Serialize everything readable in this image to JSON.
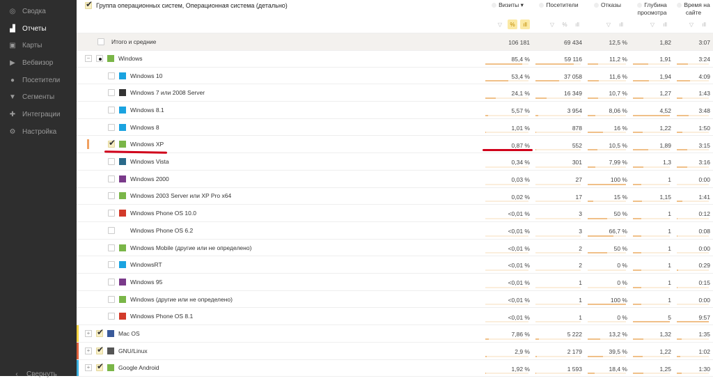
{
  "sidebar": {
    "items": [
      {
        "label": "Сводка",
        "icon": "dashboard-icon",
        "glyph": "◎"
      },
      {
        "label": "Отчеты",
        "icon": "bar-chart-icon",
        "glyph": "▟",
        "active": true
      },
      {
        "label": "Карты",
        "icon": "map-icon",
        "glyph": "▣"
      },
      {
        "label": "Вебвизор",
        "icon": "play-icon",
        "glyph": "▶"
      },
      {
        "label": "Посетители",
        "icon": "user-icon",
        "glyph": "●"
      },
      {
        "label": "Сегменты",
        "icon": "filter-icon",
        "glyph": "▼"
      },
      {
        "label": "Интеграции",
        "icon": "puzzle-icon",
        "glyph": "✚"
      },
      {
        "label": "Настройка",
        "icon": "gear-icon",
        "glyph": "⚙"
      }
    ],
    "collapse": "Свернуть"
  },
  "grouping": "Группа операционных систем, Операционная система (детально)",
  "columns": [
    {
      "label": "Визиты ▾"
    },
    {
      "label": "Посетители"
    },
    {
      "label": "Отказы"
    },
    {
      "label": "Глубина просмотра"
    },
    {
      "label": "Время на сайте"
    }
  ],
  "totals": {
    "label": "Итого и средние",
    "values": [
      "106 181",
      "69 434",
      "12,5 %",
      "1,82",
      "3:07"
    ]
  },
  "rows": [
    {
      "name": "Windows",
      "level": 0,
      "expand": "−",
      "icon": "windows-xp-icon",
      "color": "#7ab648",
      "values": [
        "85,4 %",
        "59 116",
        "11,2 %",
        "1,91",
        "3:24"
      ],
      "bars": [
        0.85,
        0.85,
        0.28,
        0.42,
        0.35
      ]
    },
    {
      "name": "Windows 10",
      "level": 1,
      "icon": "windows-10-icon",
      "color": "#1aa3e0",
      "values": [
        "53,4 %",
        "37 058",
        "11,6 %",
        "1,94",
        "4:09"
      ],
      "bars": [
        0.53,
        0.53,
        0.29,
        0.43,
        0.42
      ]
    },
    {
      "name": "Windows 7 или 2008 Server",
      "level": 1,
      "icon": "windows-7-icon",
      "color": "#333",
      "values": [
        "24,1 %",
        "16 349",
        "10,7 %",
        "1,27",
        "1:43"
      ],
      "bars": [
        0.24,
        0.24,
        0.27,
        0.28,
        0.17
      ]
    },
    {
      "name": "Windows 8.1",
      "level": 1,
      "icon": "windows-8-icon",
      "color": "#1aa3e0",
      "values": [
        "5,57 %",
        "3 954",
        "8,06 %",
        "4,52",
        "3:48"
      ],
      "bars": [
        0.06,
        0.06,
        0.2,
        1,
        0.38
      ]
    },
    {
      "name": "Windows 8",
      "level": 1,
      "icon": "windows-8-icon",
      "color": "#1aa3e0",
      "values": [
        "1,01 %",
        "878",
        "16 %",
        "1,22",
        "1:50"
      ],
      "bars": [
        0.01,
        0.01,
        0.4,
        0.27,
        0.18
      ]
    },
    {
      "name": "Windows XP",
      "level": 1,
      "checked": true,
      "icon": "windows-xp-icon",
      "color": "#7ab648",
      "values": [
        "0,87 %",
        "552",
        "10,5 %",
        "1,89",
        "3:15"
      ],
      "bars": [
        0.01,
        0.01,
        0.26,
        0.42,
        0.33
      ],
      "mark": "#f0a060"
    },
    {
      "name": "Windows Vista",
      "level": 1,
      "icon": "windows-vista-icon",
      "color": "#2a6a8a",
      "values": [
        "0,34 %",
        "301",
        "7,99 %",
        "1,3",
        "3:16"
      ],
      "bars": [
        0,
        0,
        0.2,
        0.29,
        0.33
      ]
    },
    {
      "name": "Windows 2000",
      "level": 1,
      "icon": "windows-2000-icon",
      "color": "#7a3a8a",
      "values": [
        "0,03 %",
        "27",
        "100 %",
        "1",
        "0:00"
      ],
      "bars": [
        0,
        0,
        1,
        0.22,
        0
      ]
    },
    {
      "name": "Windows 2003 Server или XP Pro x64",
      "level": 1,
      "icon": "windows-xp-icon",
      "color": "#7ab648",
      "values": [
        "0,02 %",
        "17",
        "15 %",
        "1,15",
        "1:41"
      ],
      "bars": [
        0,
        0,
        0.15,
        0.25,
        0.17
      ]
    },
    {
      "name": "Windows Phone OS 10.0",
      "level": 1,
      "icon": "windows-phone-icon",
      "color": "#d23a2a",
      "values": [
        "<0,01 %",
        "3",
        "50 %",
        "1",
        "0:12"
      ],
      "bars": [
        0,
        0,
        0.5,
        0.22,
        0.02
      ]
    },
    {
      "name": "Windows Phone OS 6.2",
      "level": 1,
      "icon": "",
      "color": "",
      "values": [
        "<0,01 %",
        "3",
        "66,7 %",
        "1",
        "0:08"
      ],
      "bars": [
        0,
        0,
        0.67,
        0.22,
        0.01
      ]
    },
    {
      "name": "Windows Mobile (другие или не определено)",
      "level": 1,
      "icon": "windows-xp-icon",
      "color": "#7ab648",
      "values": [
        "<0,01 %",
        "2",
        "50 %",
        "1",
        "0:00"
      ],
      "bars": [
        0,
        0,
        0.5,
        0.22,
        0
      ]
    },
    {
      "name": "WindowsRT",
      "level": 1,
      "icon": "windows-8-icon",
      "color": "#1aa3e0",
      "values": [
        "<0,01 %",
        "2",
        "0 %",
        "1",
        "0:29"
      ],
      "bars": [
        0,
        0,
        0,
        0.22,
        0.05
      ]
    },
    {
      "name": "Windows 95",
      "level": 1,
      "icon": "windows-95-icon",
      "color": "#7a3a8a",
      "values": [
        "<0,01 %",
        "1",
        "0 %",
        "1",
        "0:15"
      ],
      "bars": [
        0,
        0,
        0,
        0.22,
        0.03
      ]
    },
    {
      "name": "Windows (другие или не определено)",
      "level": 1,
      "icon": "windows-xp-icon",
      "color": "#7ab648",
      "values": [
        "<0,01 %",
        "1",
        "100 %",
        "1",
        "0:00"
      ],
      "bars": [
        0,
        0,
        1,
        0.22,
        0
      ]
    },
    {
      "name": "Windows Phone OS 8.1",
      "level": 1,
      "icon": "windows-phone-icon",
      "color": "#d23a2a",
      "values": [
        "<0,01 %",
        "1",
        "0 %",
        "5",
        "9:57"
      ],
      "bars": [
        0,
        0,
        0,
        1,
        1
      ]
    },
    {
      "name": "Mac OS",
      "level": 0,
      "expand": "+",
      "checked": true,
      "icon": "mac-os-icon",
      "color": "#3a5a9a",
      "values": [
        "7,86 %",
        "5 222",
        "13,2 %",
        "1,32",
        "1:35"
      ],
      "bars": [
        0.08,
        0.08,
        0.33,
        0.29,
        0.16
      ],
      "mark": "#f5d442"
    },
    {
      "name": "GNU/Linux",
      "level": 0,
      "expand": "+",
      "checked": true,
      "icon": "linux-icon",
      "color": "#555",
      "values": [
        "2,9 %",
        "2 179",
        "39,5 %",
        "1,22",
        "1:02"
      ],
      "bars": [
        0.03,
        0.03,
        0.4,
        0.27,
        0.1
      ],
      "mark": "#e0603a"
    },
    {
      "name": "Google Android",
      "level": 0,
      "expand": "+",
      "checked": true,
      "icon": "android-icon",
      "color": "#7ab648",
      "values": [
        "1,92 %",
        "1 593",
        "18,4 %",
        "1,25",
        "1:30"
      ],
      "bars": [
        0.02,
        0.02,
        0.18,
        0.28,
        0.15
      ],
      "mark": "#3ab0e0"
    }
  ]
}
